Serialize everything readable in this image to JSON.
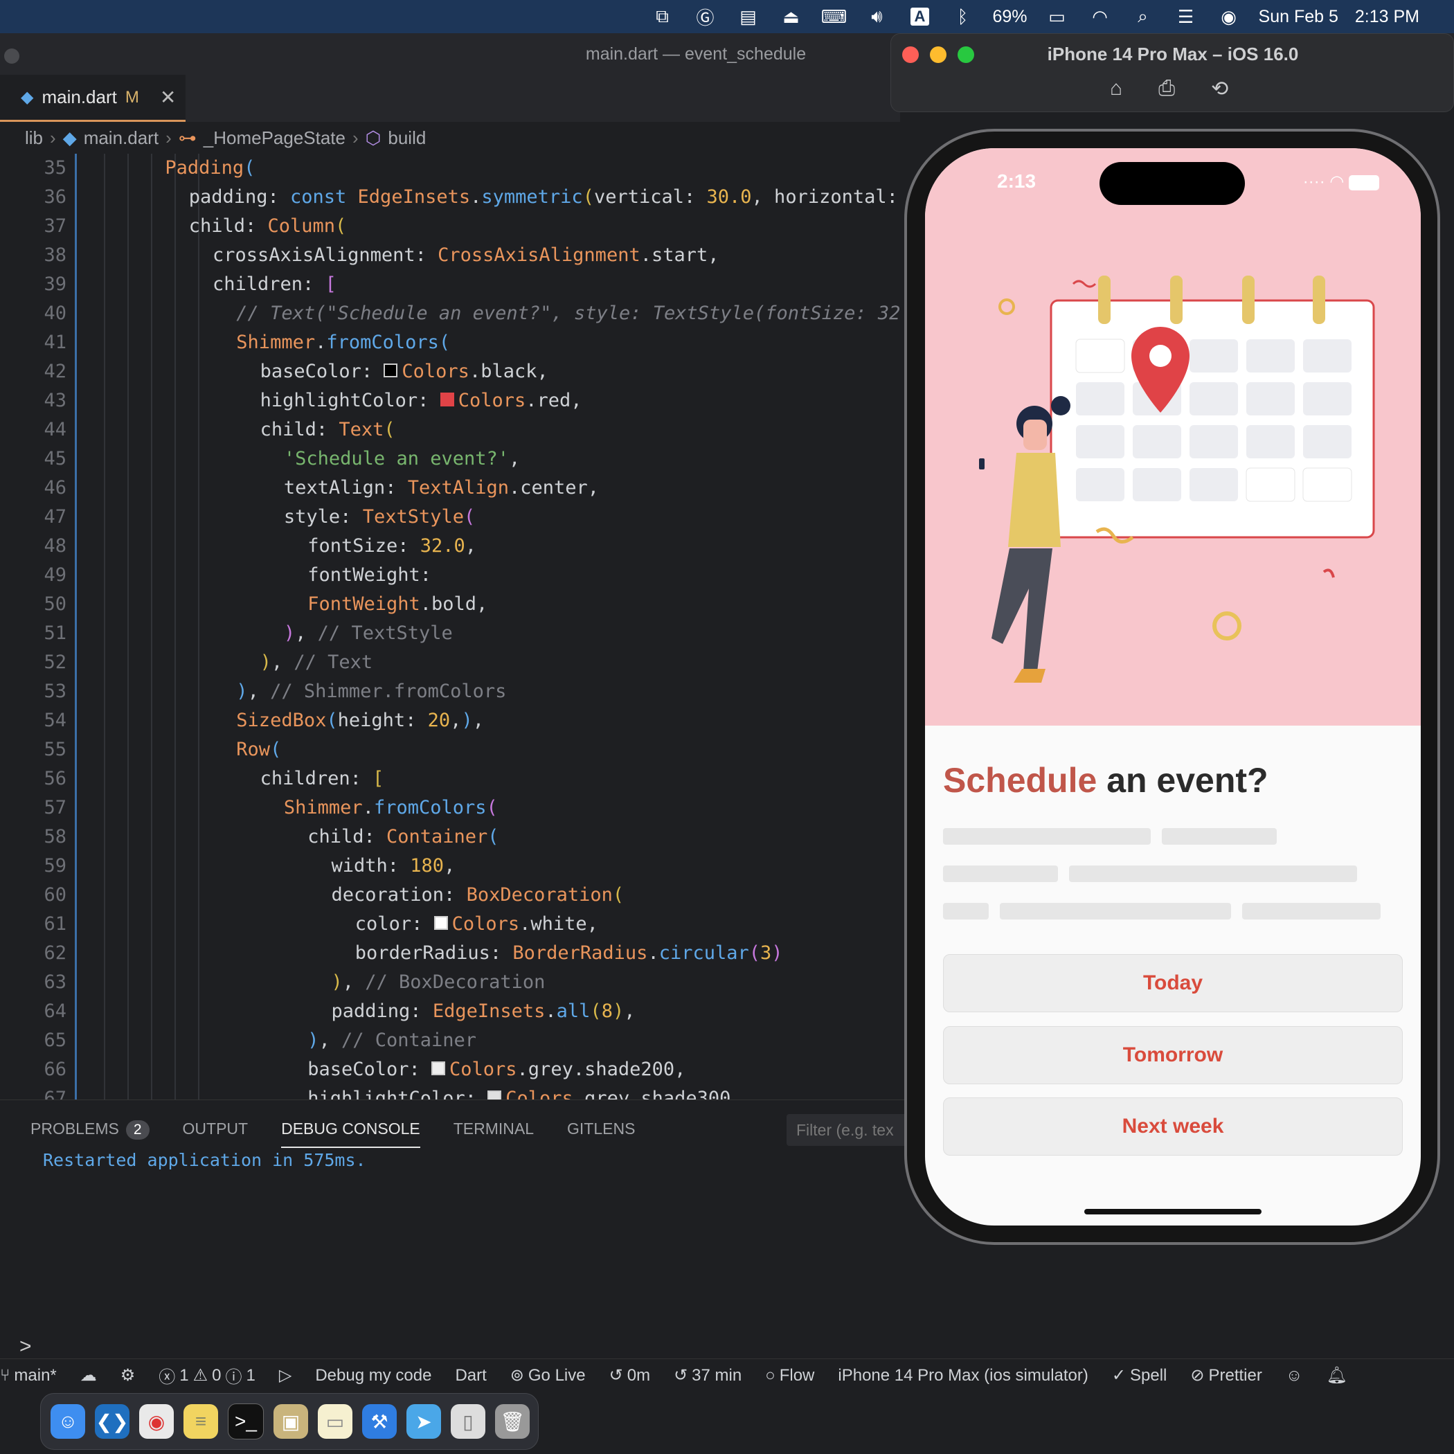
{
  "menubar": {
    "battery": "69%",
    "date": "Sun Feb 5",
    "time": "2:13 PM",
    "input_source": "A"
  },
  "editor": {
    "window_title": "main.dart — event_schedule",
    "tab": {
      "label": "main.dart",
      "modified": "M"
    },
    "breadcrumbs": [
      "lib",
      "main.dart",
      "_HomePageState",
      "build"
    ],
    "first_line": 35,
    "line_count": 33
  },
  "panel": {
    "tabs": [
      "PROBLEMS",
      "OUTPUT",
      "DEBUG CONSOLE",
      "TERMINAL",
      "GITLENS"
    ],
    "problems_count": "2",
    "filter_placeholder": "Filter (e.g. tex",
    "console_output": "Restarted application in 575ms.",
    "prompt": ">"
  },
  "status": {
    "branch": "main*",
    "errors": "1",
    "warnings": "0",
    "infos": "1",
    "debug": "Debug my code",
    "language": "Dart",
    "go_live": "Go Live",
    "timer1": "0m",
    "timer2": "37 min",
    "flow": "Flow",
    "device": "iPhone 14 Pro Max (ios simulator)",
    "spell": "Spell",
    "prettier": "Prettier"
  },
  "simulator": {
    "title": "iPhone 14 Pro Max – iOS 16.0",
    "phone_time": "2:13",
    "headline_highlight": "Schedule",
    "headline_rest": " an event?",
    "buttons": [
      "Today",
      "Tomorrow",
      "Next week"
    ]
  },
  "colors": {
    "accent": "#d94b3c",
    "hero_bg": "#f8c6cc",
    "menubar": "#1d3658"
  }
}
